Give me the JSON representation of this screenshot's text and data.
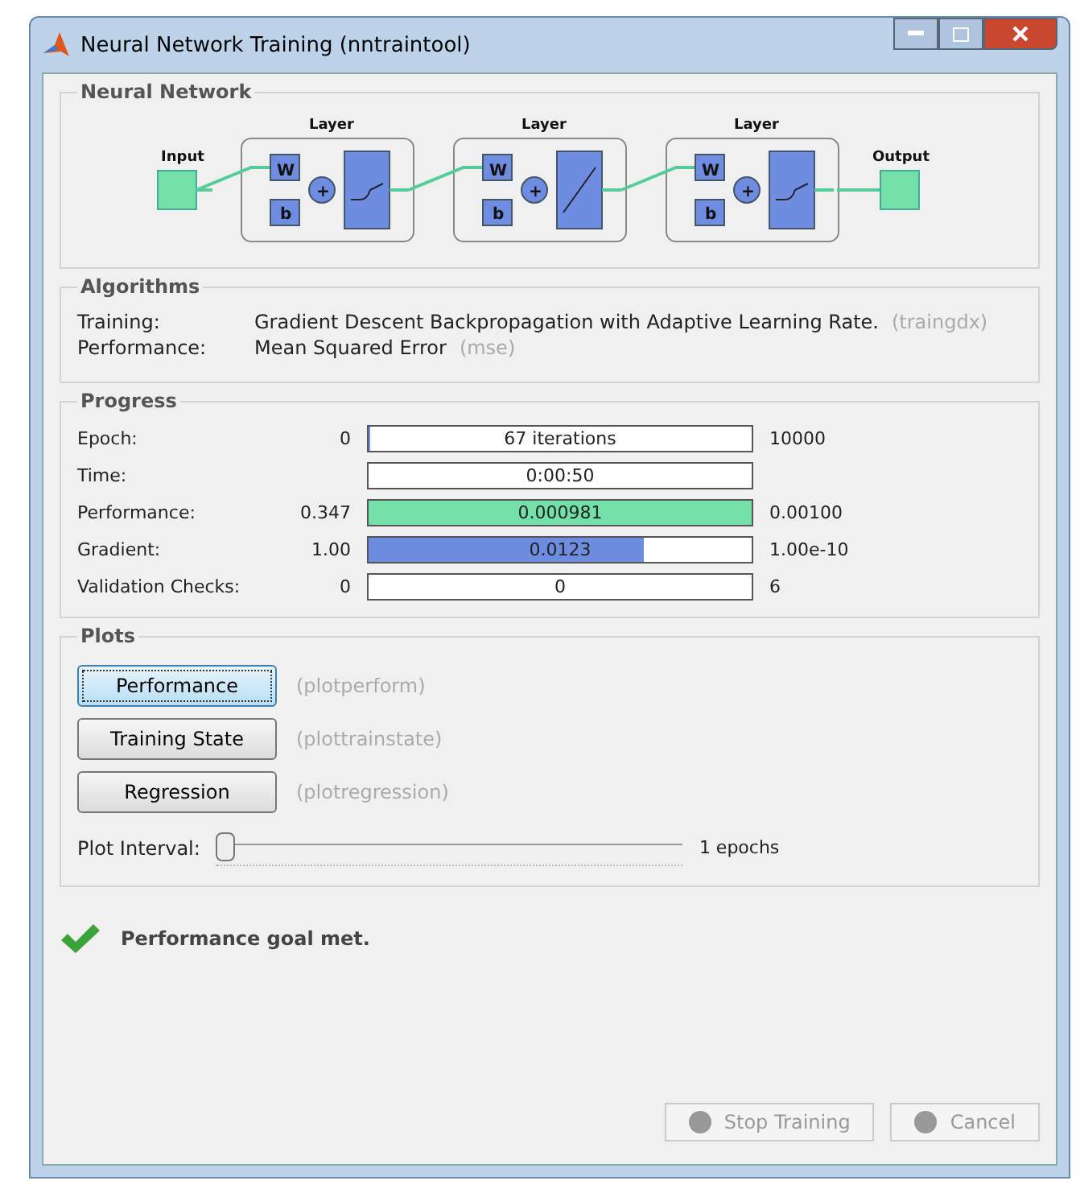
{
  "window": {
    "title": "Neural Network Training (nntraintool)"
  },
  "network": {
    "title": "Neural Network",
    "input": "Input",
    "output": "Output",
    "layers": [
      {
        "label": "Layer",
        "weight": "W",
        "bias": "b",
        "sum": "+",
        "kind": "sigmoid"
      },
      {
        "label": "Layer",
        "weight": "W",
        "bias": "b",
        "sum": "+",
        "kind": "linear"
      },
      {
        "label": "Layer",
        "weight": "W",
        "bias": "b",
        "sum": "+",
        "kind": "sigmoid"
      }
    ]
  },
  "algorithms": {
    "title": "Algorithms",
    "rows": [
      {
        "label": "Training:",
        "value": "Gradient Descent Backpropagation with Adaptive Learning Rate.",
        "code": "(traingdx)"
      },
      {
        "label": "Performance:",
        "value": "Mean Squared Error",
        "code": "(mse)"
      }
    ]
  },
  "progress": {
    "title": "Progress",
    "rows": [
      {
        "label": "Epoch:",
        "start": "0",
        "reading": "67 iterations",
        "end": "10000",
        "level": 0.006,
        "color": "#6f8de0"
      },
      {
        "label": "Time:",
        "reading": "0:00:50"
      },
      {
        "label": "Performance:",
        "start": "0.347",
        "reading": "0.000981",
        "end": "0.00100",
        "level": 1,
        "color": "#72e0a8"
      },
      {
        "label": "Gradient:",
        "start": "1.00",
        "reading": "0.0123",
        "end": "1.00e-10",
        "level": 0.72,
        "color": "#6f8de0"
      },
      {
        "label": "Validation Checks:",
        "start": "0",
        "reading": "0",
        "end": "6"
      }
    ]
  },
  "plots": {
    "title": "Plots",
    "buttons": [
      {
        "label": "Performance",
        "code": "(plotperform)",
        "selected": true
      },
      {
        "label": "Training State",
        "code": "(plottrainstate)",
        "selected": false
      },
      {
        "label": "Regression",
        "code": "(plotregression)",
        "selected": false
      }
    ],
    "interval": {
      "label": "Plot Interval:",
      "level": 0,
      "reading": "1 epochs"
    }
  },
  "status": {
    "message": "Performance goal met."
  },
  "buttons": [
    {
      "label": "Stop Training",
      "disabled": true
    },
    {
      "label": "Cancel",
      "disabled": true
    }
  ]
}
